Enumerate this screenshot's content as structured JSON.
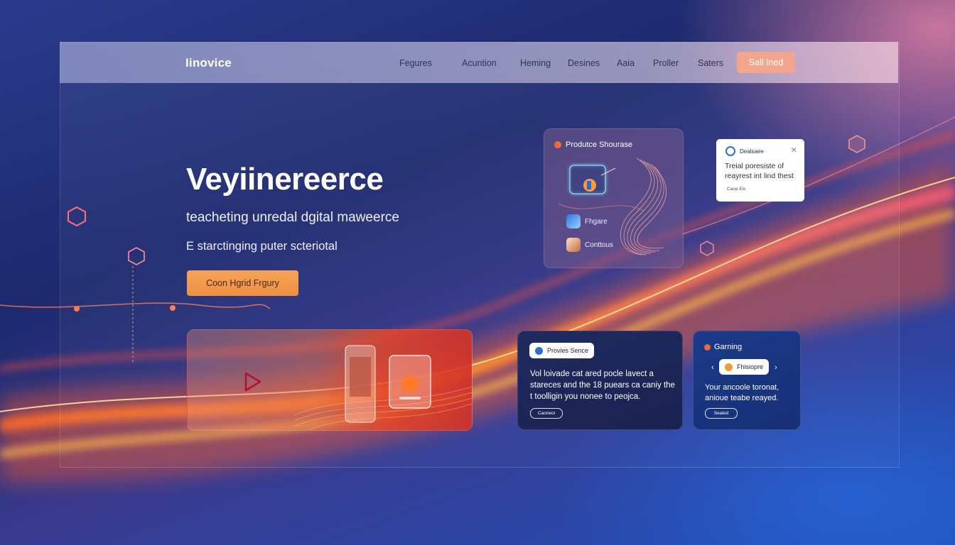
{
  "nav": {
    "logo": "Iinovice",
    "links": [
      "Fegures",
      "Acuntion",
      "Heming",
      "Desines",
      "Aaia",
      "Proller",
      "Saters"
    ],
    "cta": "Sall Ined"
  },
  "hero": {
    "title": "Veyiinereerce",
    "subtitle": "teacheting unredal dgital maweerce",
    "description": "E starctinging puter scteriotal",
    "button": "Coon Hgrid Frgury"
  },
  "showcase_card": {
    "title": "Produtce Shourase",
    "items": [
      "Fhgare",
      "Conttous"
    ]
  },
  "popup": {
    "title": "Dealsaee",
    "body": "Treial poresiste of reayrest int lind thest",
    "footer": "Caoe Eis"
  },
  "preview_card": {
    "chip": "Provies Sence",
    "text": "Vol loivade cat ared pocle lavect a stareces and the 18 puears ca caniy the t toolligin you nonee to peojca.",
    "button": "Caoneoi"
  },
  "gaming_card": {
    "title": "Garning",
    "chip": "Fhisiopre",
    "text": "Your ancoole toronat, anioue teabe reayed.",
    "button": "Seated"
  },
  "colors": {
    "accent": "#f3a58e",
    "hero_button": "#f29a4c",
    "wave": "#ff8a2a"
  }
}
